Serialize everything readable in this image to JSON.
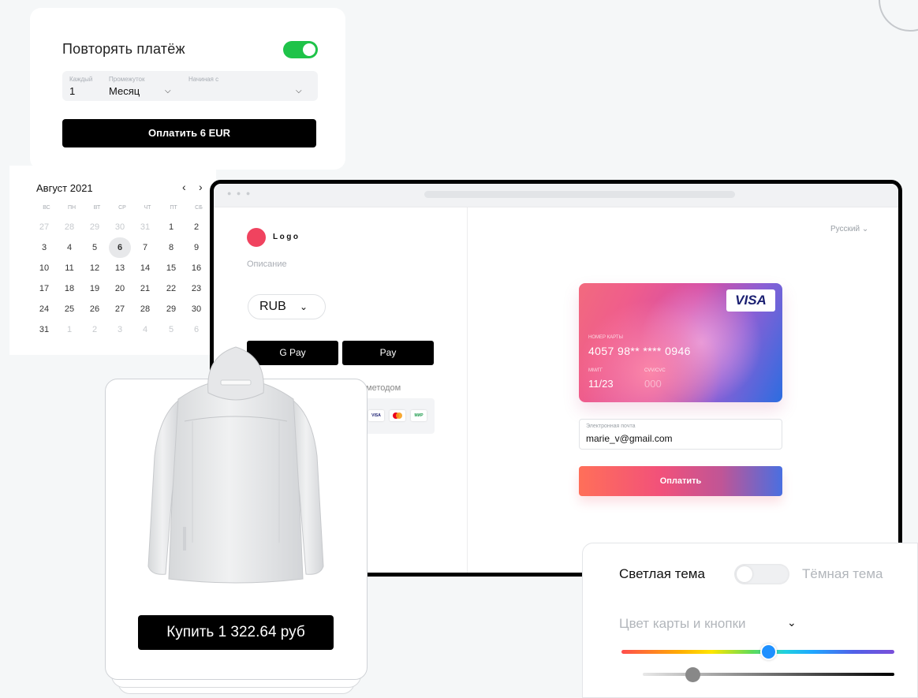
{
  "recurring": {
    "title": "Повторять платёж",
    "toggle_on": true,
    "every_label": "Каждый",
    "every_value": "1",
    "interval_label": "Промежуток",
    "interval_value": "Месяц",
    "start_label": "Начиная с",
    "pay_label": "Оплатить 6 EUR"
  },
  "calendar": {
    "month": "Август 2021",
    "prev": "‹",
    "next": "›",
    "weekdays": [
      "вс",
      "пн",
      "вт",
      "ср",
      "чт",
      "пт",
      "сб"
    ],
    "weeks": [
      [
        "27",
        "28",
        "29",
        "30",
        "31",
        "1",
        "2"
      ],
      [
        "3",
        "4",
        "5",
        "6",
        "7",
        "8",
        "9"
      ],
      [
        "10",
        "11",
        "12",
        "13",
        "14",
        "15",
        "16"
      ],
      [
        "17",
        "18",
        "19",
        "20",
        "21",
        "22",
        "23"
      ],
      [
        "24",
        "25",
        "26",
        "27",
        "28",
        "29",
        "30"
      ],
      [
        "31",
        "1",
        "2",
        "3",
        "4",
        "5",
        "6"
      ]
    ],
    "selected_day": "6"
  },
  "checkout": {
    "logo_text": "Logo",
    "description": "Описание",
    "currency": "RUB",
    "gpay_label": "G Pay",
    "apay_label": " Pay",
    "method_text": "методом",
    "payment_logos": [
      "VISA",
      "MC",
      "МИР"
    ],
    "language": "Русский ⌄",
    "card": {
      "brand": "VISA",
      "number_label": "НОМЕР КАРТЫ",
      "number": "4057 98** **** 0946",
      "expiry_label": "ММ/ГГ",
      "expiry": "11/23",
      "cvv_label": "CVV/CVC",
      "cvv": "000"
    },
    "email_label": "Электронная почта",
    "email_value": "marie_v@gmail.com",
    "pay_label": "Оплатить"
  },
  "product": {
    "buy_label": "Купить 1 322.64 руб"
  },
  "theme": {
    "light_label": "Светлая тема",
    "dark_label": "Тёмная тема",
    "color_label": "Цвет карты и кнопки",
    "hue_value": 0.54,
    "shade_value": 0.2
  },
  "colors": {
    "toggle_green": "#1fc349",
    "logo_red": "#f0435f",
    "visa_blue": "#1a1f71"
  }
}
